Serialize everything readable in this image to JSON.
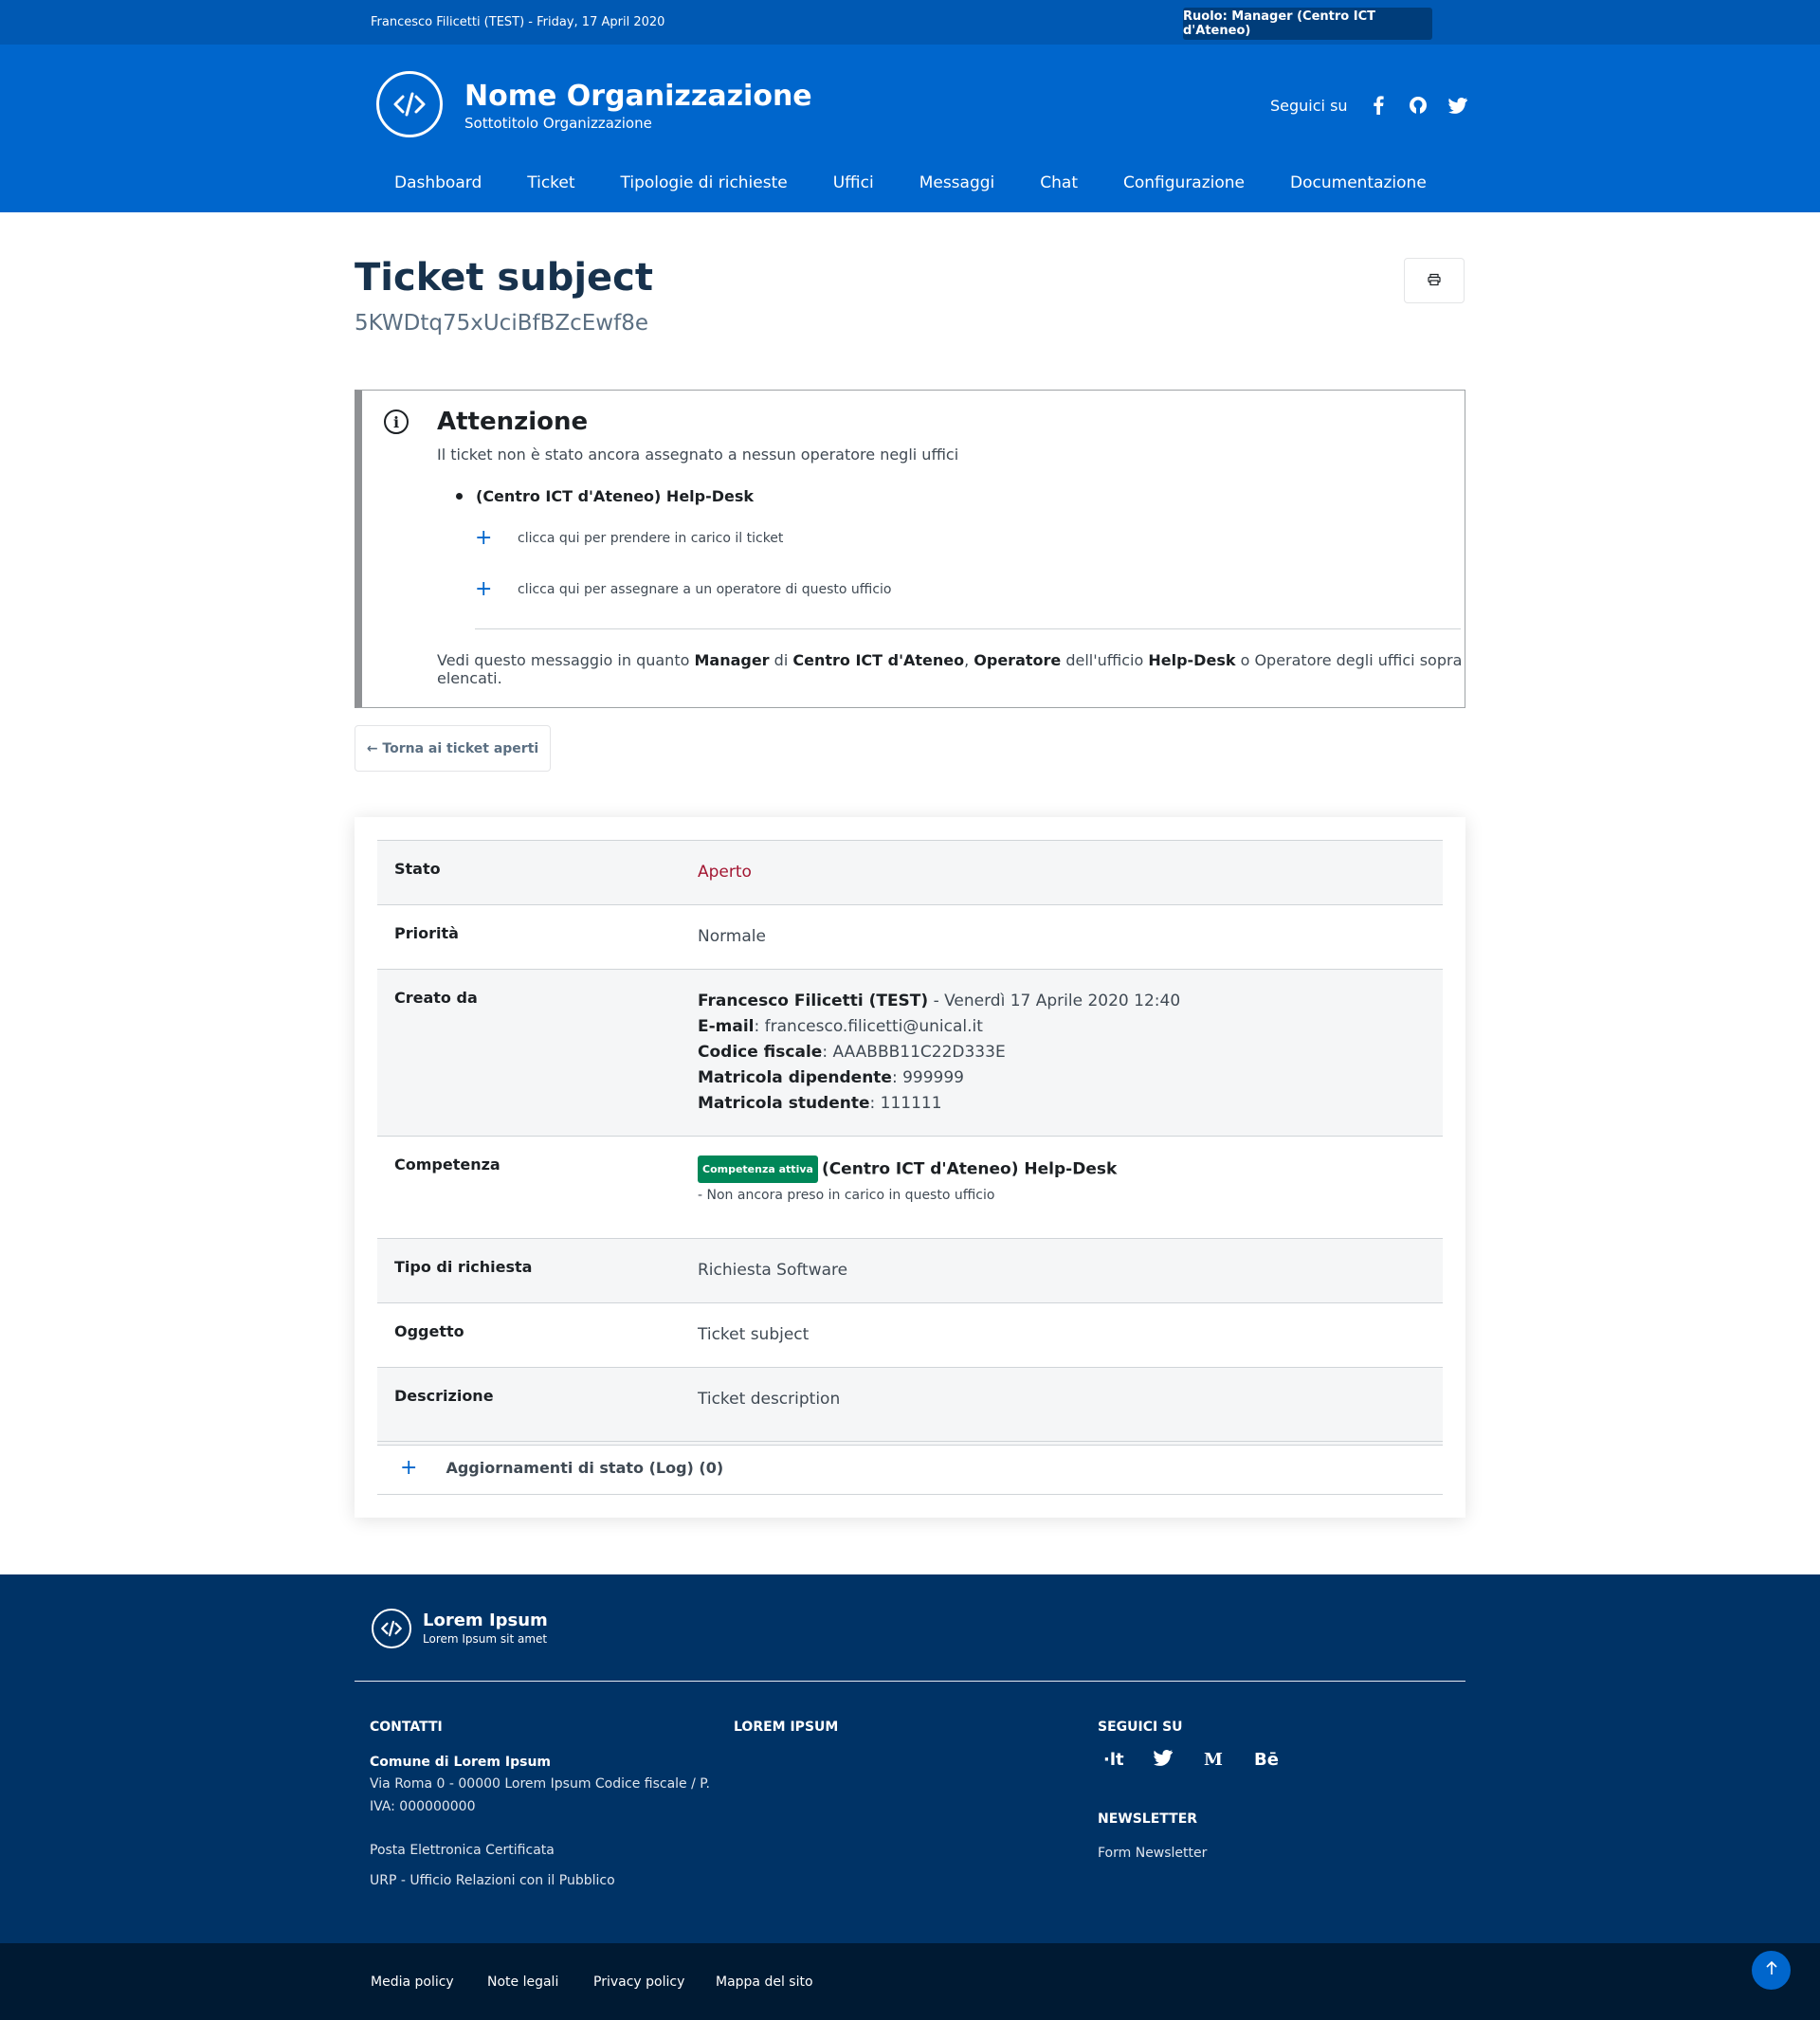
{
  "slim": {
    "user": "Francesco Filicetti (TEST) - Friday, 17 April 2020",
    "role": "Ruolo: Manager (Centro ICT d'Ateneo)"
  },
  "header": {
    "org_name": "Nome Organizzazione",
    "org_sub": "Sottotitolo Organizzazione",
    "follow": "Seguici su",
    "social_icons": [
      "facebook-icon",
      "github-icon",
      "twitter-icon"
    ],
    "nav": [
      "Dashboard",
      "Ticket",
      "Tipologie di richieste",
      "Uffici",
      "Messaggi",
      "Chat",
      "Configurazione",
      "Documentazione"
    ]
  },
  "ticket": {
    "title": "Ticket subject",
    "code": "5KWDtq75xUciBfBZcEwf8e"
  },
  "callout": {
    "title": "Attenzione",
    "message": "Il ticket non è stato ancora assegnato a nessun operatore negli uffici",
    "office": "(Centro ICT d'Ateneo) Help-Desk",
    "action_take": "clicca qui per prendere in carico il ticket",
    "action_assign": "clicca qui per assegnare a un operatore di questo ufficio",
    "note": {
      "p1": "Vedi questo messaggio in quanto ",
      "b1": "Manager",
      "p2": " di ",
      "b2": "Centro ICT d'Ateneo",
      "p3": ", ",
      "b3": "Operatore",
      "p4": " dell'ufficio ",
      "b4": "Help-Desk",
      "p5": " o Operatore degli uffici sopra elencati."
    }
  },
  "back_button": "← Torna ai ticket aperti",
  "details": {
    "stato": {
      "label": "Stato",
      "value": "Aperto",
      "color": "#a31632"
    },
    "priorita": {
      "label": "Priorità",
      "value": "Normale"
    },
    "creato": {
      "label": "Creato da",
      "name": "Francesco Filicetti (TEST)",
      "date": " - Venerdì 17 Aprile 2020 12:40",
      "email_label": "E-mail",
      "email": ": francesco.filicetti@unical.it",
      "cf_label": "Codice fiscale",
      "cf": ": AAABBB11C22D333E",
      "md_label": "Matricola dipendente",
      "md": ": 999999",
      "ms_label": "Matricola studente",
      "ms": ": 111111"
    },
    "competenza": {
      "label": "Competenza",
      "badge": "Competenza attiva",
      "office": "(Centro ICT d'Ateneo) Help-Desk",
      "note": "- Non ancora preso in carico in questo ufficio"
    },
    "tipo": {
      "label": "Tipo di richiesta",
      "value": "Richiesta Software"
    },
    "oggetto": {
      "label": "Oggetto",
      "value": "Ticket subject"
    },
    "descrizione": {
      "label": "Descrizione",
      "value": "Ticket description"
    }
  },
  "log_label": "Aggiornamenti di stato (Log) (0)",
  "footer": {
    "name": "Lorem Ipsum",
    "sub": "Lorem Ipsum sit amet",
    "contatti": "CONTATTI",
    "comune": "Comune di Lorem Ipsum",
    "address1": "Via Roma 0 - 00000 Lorem Ipsum Codice fiscale / P.",
    "address2": "IVA: 000000000",
    "pec": "Posta Elettronica Certificata",
    "urp": "URP - Ufficio Relazioni con il Pubblico",
    "lorem": "LOREM IPSUM",
    "seguici": "SEGUICI SU",
    "social": [
      "·lt",
      "🐦",
      "M",
      "Bē"
    ],
    "newsletter": "NEWSLETTER",
    "form_newsletter": "Form Newsletter"
  },
  "bottom_links": [
    "Media policy",
    "Note legali",
    "Privacy policy",
    "Mappa del sito"
  ]
}
